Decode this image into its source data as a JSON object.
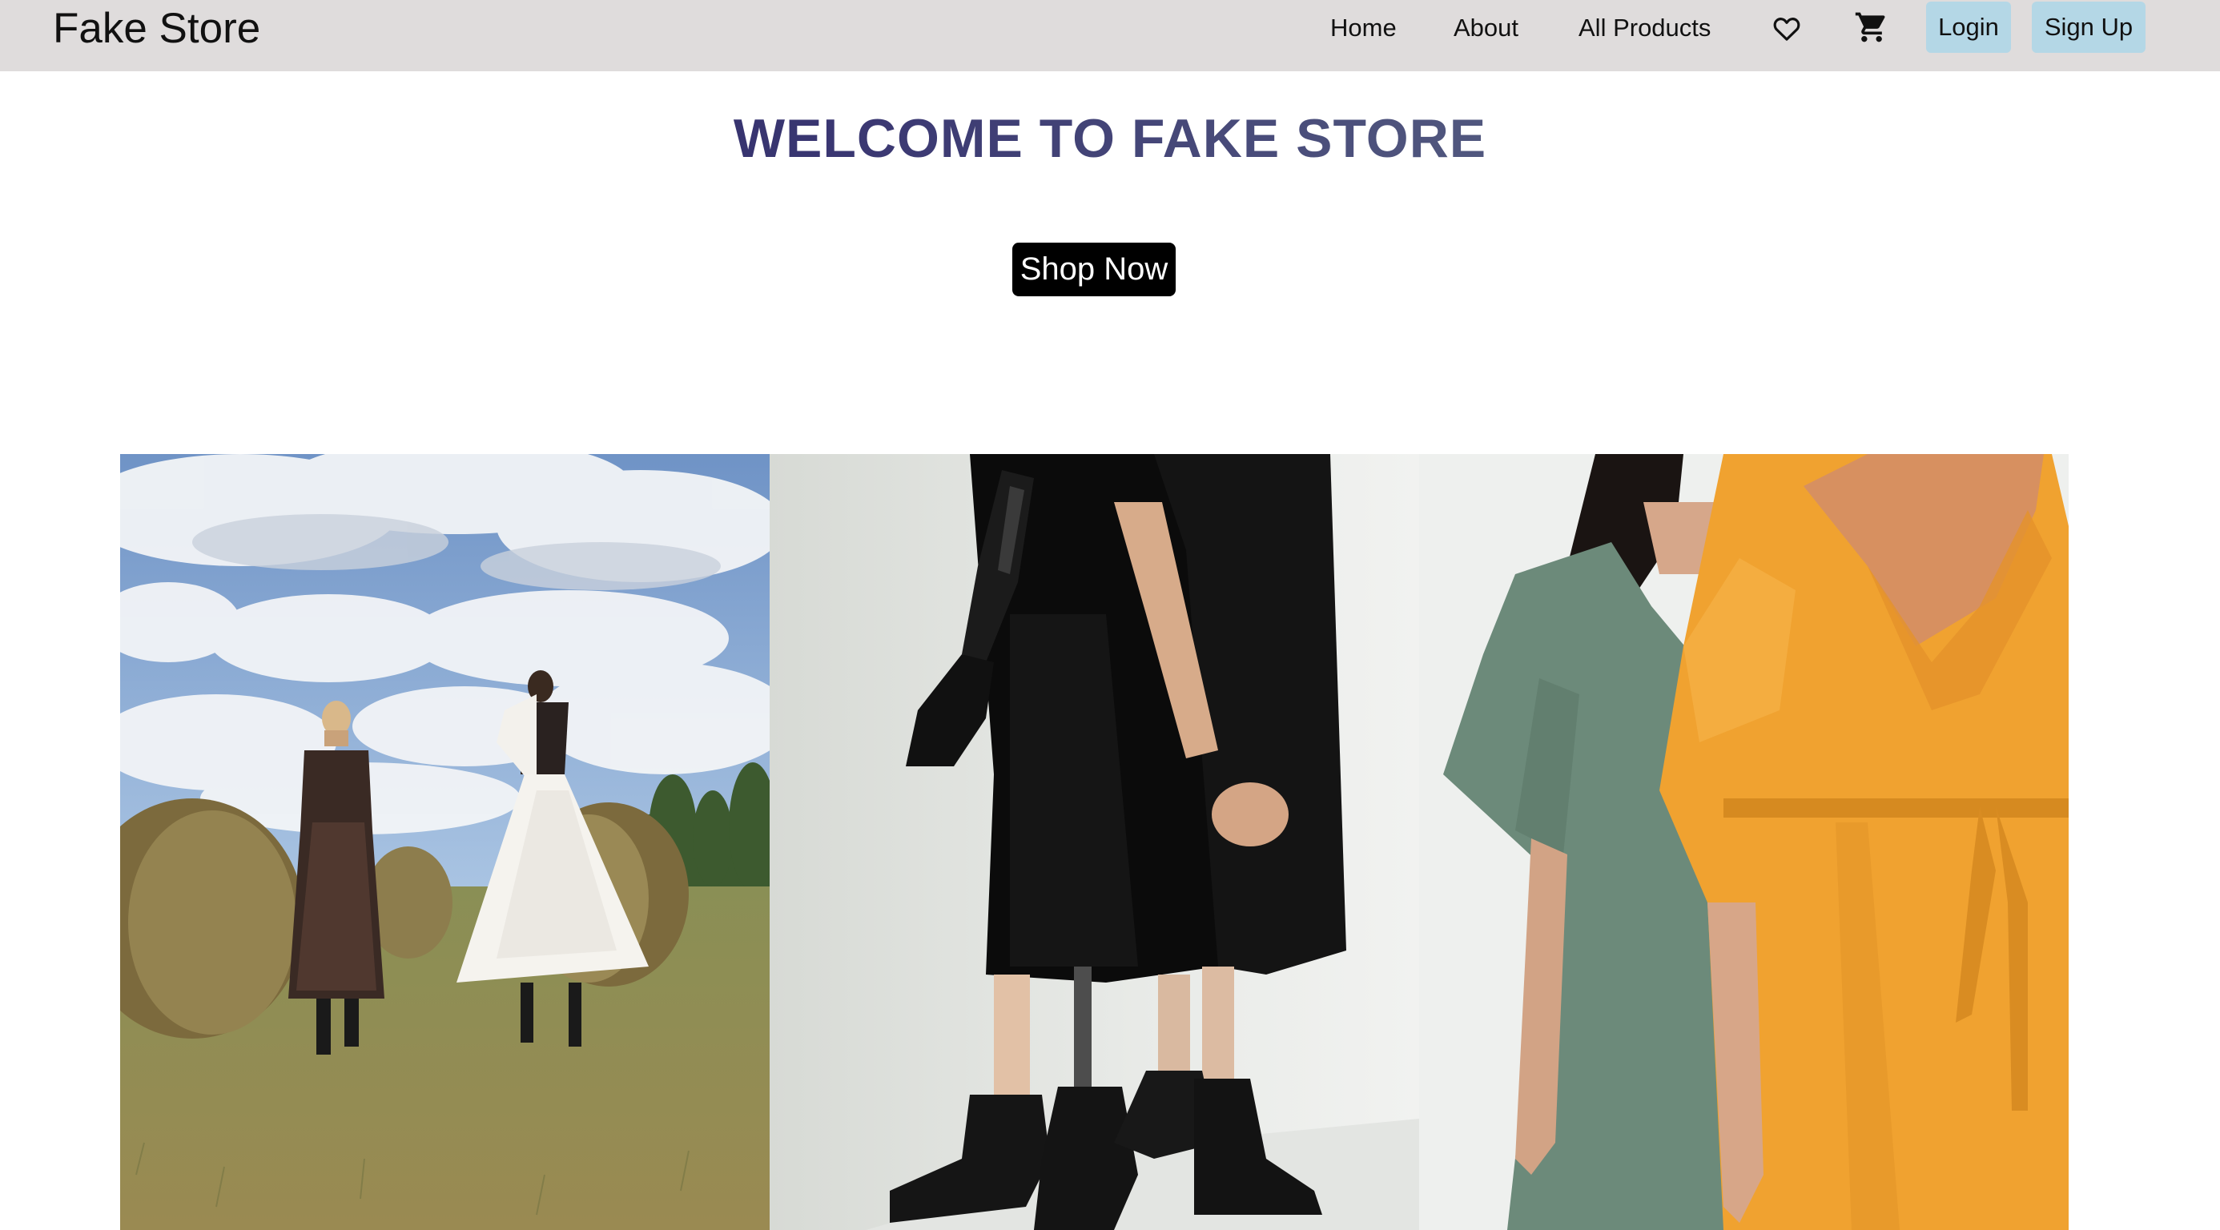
{
  "navbar": {
    "brand": "Fake Store",
    "links": [
      "Home",
      "About",
      "All Products"
    ],
    "icons": [
      "heart-icon",
      "cart-icon"
    ],
    "login_label": "Login",
    "signup_label": "Sign Up",
    "background": "#dfdcdc",
    "auth_button_color": "#b4d7e6"
  },
  "hero": {
    "title": "WELCOME TO FAKE STORE",
    "cta_label": "Shop Now"
  },
  "gallery": {
    "photos": [
      "women-in-dresses-hay-field-photo",
      "black-dress-prosthetic-limbs-photo",
      "green-and-orange-linen-dresses-photo"
    ]
  }
}
